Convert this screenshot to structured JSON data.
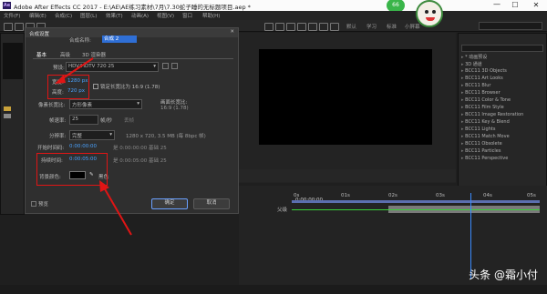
{
  "app": {
    "window_title": "Adobe After Effects CC 2017 - E:\\AE\\AE练习素材\\7月\\7.30蛇子睡的无标题项目.aep *",
    "icon_label": "Ae",
    "badge": "66",
    "menu": [
      "文件(F)",
      "编辑(E)",
      "合成(C)",
      "图层(L)",
      "效果(T)",
      "动画(A)",
      "视图(V)",
      "窗口",
      "帮助(H)"
    ],
    "workspace_tabs": [
      "默认",
      "学习",
      "标准",
      "小屏幕"
    ]
  },
  "dialog": {
    "title": "合成设置",
    "name_label": "合成名称:",
    "name_value": "合成 2",
    "tabs": [
      "基本",
      "高级",
      "3D 渲染器"
    ],
    "preset_label": "预设:",
    "preset_value": "HDV/HDTV 720 25",
    "width_label": "宽度:",
    "width_value": "1280 px",
    "height_label": "高度:",
    "height_value": "720 px",
    "lock_aspect": "锁定长宽比为 16:9 (1.78)",
    "pixel_aspect_label": "像素长宽比:",
    "pixel_aspect_value": "方形像素",
    "frame_aspect_label": "画面长宽比:",
    "frame_aspect_value": "16:9 (1.78)",
    "frame_rate_label": "帧速率:",
    "frame_rate_value": "25",
    "frame_rate_unit": "帧/秒",
    "frame_rate_mode": "丢帧",
    "resolution_label": "分辨率:",
    "resolution_value": "完整",
    "resolution_info": "1280 x 720, 3.5 MB (每 8bpc 帧)",
    "start_tc_label": "开始时间码:",
    "start_tc_value": "0:00:00:00",
    "start_tc_note": "是 0:00:00:00 基础 25",
    "duration_label": "持续时间:",
    "duration_value": "0:00:05:00",
    "duration_note": "是 0:00:05:00 基础 25",
    "bg_color_label": "背景颜色:",
    "bg_color_name": "黑色",
    "preview_label": "预览",
    "ok_label": "确定",
    "cancel_label": "取消"
  },
  "effects_panel": {
    "items": [
      "* 动画预设",
      "3D 通道",
      "BCC11 3D Objects",
      "BCC11 Art Looks",
      "BCC11 Blur",
      "BCC11 Browser",
      "BCC11 Color & Tone",
      "BCC11 Film Style",
      "BCC11 Image Restoration",
      "BCC11 Key & Blend",
      "BCC11 Lights",
      "BCC11 Match Move",
      "BCC11 Obsolete",
      "BCC11 Particles",
      "BCC11 Perspective"
    ]
  },
  "timeline": {
    "time_display": "0:00:00:00",
    "ruler": [
      "0s",
      "01s",
      "02s",
      "03s",
      "04s",
      "05s"
    ],
    "layer_label": "父级"
  },
  "watermark": "头条 @霜小付",
  "colors": {
    "accent_blue": "#4aa3ff",
    "highlight_red": "#e01515",
    "bg_color_swatch": "#000000"
  }
}
